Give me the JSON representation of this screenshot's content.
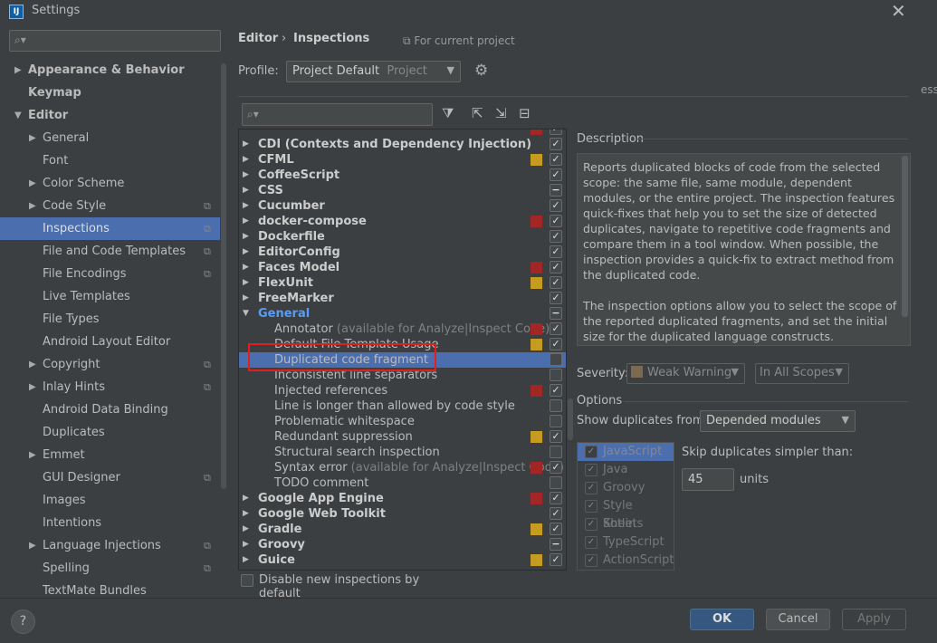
{
  "window": {
    "title": "Settings",
    "close": "✕",
    "logo": "IJ"
  },
  "left_search": {
    "placeholder": ""
  },
  "nav": [
    {
      "label": "Appearance & Behavior",
      "level": 0,
      "arrow": "▶",
      "bold": true
    },
    {
      "label": "Keymap",
      "level": 0,
      "bold": true
    },
    {
      "label": "Editor",
      "level": 0,
      "arrow": "▼",
      "bold": true
    },
    {
      "label": "General",
      "level": 1,
      "arrow": "▶"
    },
    {
      "label": "Font",
      "level": 1
    },
    {
      "label": "Color Scheme",
      "level": 1,
      "arrow": "▶"
    },
    {
      "label": "Code Style",
      "level": 1,
      "arrow": "▶",
      "copy": true
    },
    {
      "label": "Inspections",
      "level": 1,
      "copy": true,
      "selected": true
    },
    {
      "label": "File and Code Templates",
      "level": 1,
      "copy": true
    },
    {
      "label": "File Encodings",
      "level": 1,
      "copy": true
    },
    {
      "label": "Live Templates",
      "level": 1
    },
    {
      "label": "File Types",
      "level": 1
    },
    {
      "label": "Android Layout Editor",
      "level": 1
    },
    {
      "label": "Copyright",
      "level": 1,
      "arrow": "▶",
      "copy": true
    },
    {
      "label": "Inlay Hints",
      "level": 1,
      "arrow": "▶",
      "copy": true
    },
    {
      "label": "Android Data Binding",
      "level": 1
    },
    {
      "label": "Duplicates",
      "level": 1
    },
    {
      "label": "Emmet",
      "level": 1,
      "arrow": "▶"
    },
    {
      "label": "GUI Designer",
      "level": 1,
      "copy": true
    },
    {
      "label": "Images",
      "level": 1
    },
    {
      "label": "Intentions",
      "level": 1
    },
    {
      "label": "Language Injections",
      "level": 1,
      "arrow": "▶",
      "copy": true
    },
    {
      "label": "Spelling",
      "level": 1,
      "copy": true
    },
    {
      "label": "TextMate Bundles",
      "level": 1
    }
  ],
  "breadcrumb": {
    "part1": "Editor",
    "sep": "›",
    "part2": "Inspections",
    "project_note": "⧉ For current project"
  },
  "profile": {
    "label": "Profile:",
    "value": "Project Default",
    "sub": "Project"
  },
  "tree": [
    {
      "label": "CDI (Contexts and Dependency Injection)",
      "group": true,
      "check": "✓"
    },
    {
      "label": "CFML",
      "group": true,
      "sev": "#c69b22",
      "check": "✓"
    },
    {
      "label": "CoffeeScript",
      "group": true,
      "check": "✓"
    },
    {
      "label": "CSS",
      "group": true,
      "check": "−"
    },
    {
      "label": "Cucumber",
      "group": true,
      "check": "✓"
    },
    {
      "label": "docker-compose",
      "group": true,
      "sev": "#a32626",
      "check": "✓"
    },
    {
      "label": "Dockerfile",
      "group": true,
      "check": "✓"
    },
    {
      "label": "EditorConfig",
      "group": true,
      "check": "✓"
    },
    {
      "label": "Faces Model",
      "group": true,
      "sev": "#a32626",
      "check": "✓"
    },
    {
      "label": "FlexUnit",
      "group": true,
      "sev": "#c69b22",
      "check": "✓"
    },
    {
      "label": "FreeMarker",
      "group": true,
      "check": "✓"
    },
    {
      "label": "General",
      "group": true,
      "open": true,
      "check": "−",
      "blue": true
    },
    {
      "label": "Annotator",
      "note": " (available for Analyze|Inspect Code)",
      "sev": "#a32626",
      "check": "✓"
    },
    {
      "label": "Default File Template Usage",
      "sev": "#c69b22",
      "check": "✓"
    },
    {
      "label": "Duplicated code fragment",
      "selected": true,
      "check": ""
    },
    {
      "label": "Inconsistent line separators",
      "check": ""
    },
    {
      "label": "Injected references",
      "sev": "#a32626",
      "check": "✓"
    },
    {
      "label": "Line is longer than allowed by code style",
      "check": ""
    },
    {
      "label": "Problematic whitespace",
      "check": ""
    },
    {
      "label": "Redundant suppression",
      "sev": "#c69b22",
      "check": "✓"
    },
    {
      "label": "Structural search inspection",
      "check": ""
    },
    {
      "label": "Syntax error",
      "note": " (available for Analyze|Inspect Code)",
      "sev": "#a32626",
      "check": "✓"
    },
    {
      "label": "TODO comment",
      "check": ""
    },
    {
      "label": "Google App Engine",
      "group": true,
      "sev": "#a32626",
      "check": "✓"
    },
    {
      "label": "Google Web Toolkit",
      "group": true,
      "check": "✓"
    },
    {
      "label": "Gradle",
      "group": true,
      "sev": "#c69b22",
      "check": "✓"
    },
    {
      "label": "Groovy",
      "group": true,
      "check": "−"
    },
    {
      "label": "Guice",
      "group": true,
      "sev": "#c69b22",
      "check": "✓"
    }
  ],
  "disable_new": {
    "label": "Disable new inspections by default"
  },
  "description": {
    "heading": "Description",
    "para1": "Reports duplicated blocks of code from the selected scope: the same file, same module, dependent modules, or the entire project. The inspection features quick-fixes that help you to set the size of detected duplicates, navigate to repetitive code fragments and compare them in a tool window. When possible, the inspection provides a quick-fix to extract method from the duplicated code.",
    "para2": "The inspection options allow you to select the scope of the reported duplicated fragments, and set the initial size for the duplicated language constructs."
  },
  "severity": {
    "label": "Severity:",
    "value": "Weak Warning",
    "scope": "In All Scopes",
    "swatch": "#7a6a4f"
  },
  "options": {
    "heading": "Options",
    "show_label": "Show duplicates from:",
    "show_value": "Depended modules",
    "skip_label": "Skip duplicates simpler than:",
    "skip_value": "45",
    "units": "units",
    "languages": [
      "JavaScript",
      "Java",
      "Groovy",
      "Style Sheets",
      "Kotlin",
      "TypeScript",
      "ActionScript"
    ]
  },
  "buttons": {
    "ok": "OK",
    "cancel": "Cancel",
    "apply": "Apply",
    "help": "?"
  },
  "colors": {
    "selection": "#4b6eaf",
    "accent_blue": "#589df6",
    "error_red": "#a32626",
    "warning_yellow": "#c69b22",
    "highlight_box": "#e0201c"
  }
}
